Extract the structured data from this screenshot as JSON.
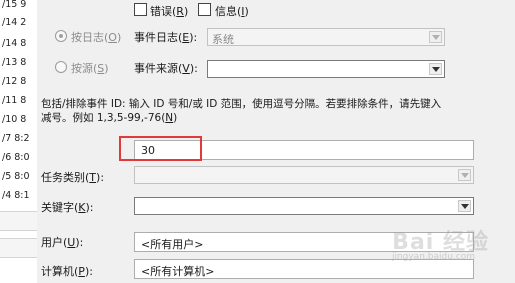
{
  "background_list": {
    "rows": [
      "/15 9",
      "/14 2",
      "/14 8",
      "/13 8",
      "/12 8",
      "/11 8",
      "/10 8",
      "/7 8:2",
      "/6 8:0",
      "/5 8:0",
      "/4 8:1"
    ]
  },
  "event_level": {
    "error": {
      "label": "错误",
      "key": "R"
    },
    "info": {
      "label": "信息",
      "key": "I"
    }
  },
  "filter_by": {
    "by_log": {
      "label": "按日志",
      "key": "O"
    },
    "event_log": {
      "label": "事件日志",
      "key": "E",
      "value": "系统"
    },
    "by_source": {
      "label": "按源",
      "key": "S"
    },
    "event_source": {
      "label": "事件来源",
      "key": "V",
      "value": ""
    }
  },
  "event_ids": {
    "description_line1": "包括/排除事件 ID: 输入 ID 号和/或 ID 范围，使用逗号分隔。若要排除条件，请先键入",
    "description_line2_prefix": "减号。例如 1,3,5-99,-76(",
    "description_key": "N",
    "description_line2_suffix": ")",
    "value": "30"
  },
  "task_category": {
    "label": "任务类别",
    "key": "T",
    "value": ""
  },
  "keywords": {
    "label": "关键字",
    "key": "K",
    "value": ""
  },
  "user": {
    "label": "用户",
    "key": "U",
    "value": "<所有用户>"
  },
  "computer": {
    "label": "计算机",
    "key": "P",
    "value": "<所有计算机>"
  },
  "watermark": {
    "text": "Bai 经验",
    "sub": "jingyan.baidu.com"
  }
}
